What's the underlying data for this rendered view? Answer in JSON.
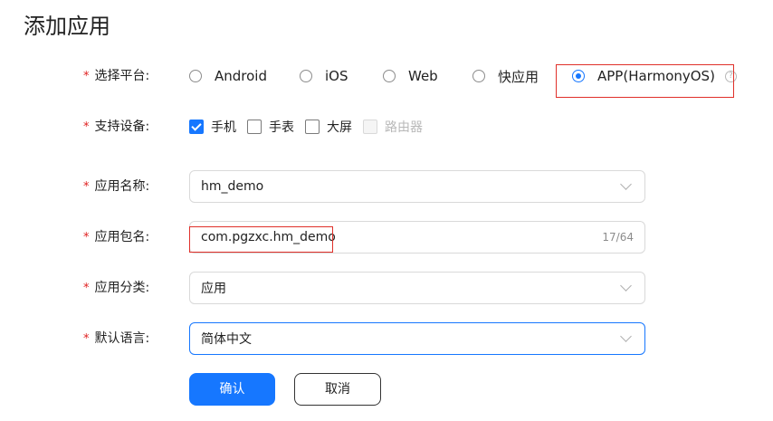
{
  "page": {
    "title": "添加应用"
  },
  "form": {
    "platform": {
      "label": "选择平台:",
      "required_mark": "*",
      "options": [
        "Android",
        "iOS",
        "Web",
        "快应用",
        "APP(HarmonyOS)"
      ],
      "selected": "APP(HarmonyOS)",
      "help_glyph": "?"
    },
    "devices": {
      "label": "支持设备:",
      "required_mark": "*",
      "options": [
        {
          "label": "手机",
          "checked": true,
          "disabled": false
        },
        {
          "label": "手表",
          "checked": false,
          "disabled": false
        },
        {
          "label": "大屏",
          "checked": false,
          "disabled": false
        },
        {
          "label": "路由器",
          "checked": false,
          "disabled": true
        }
      ]
    },
    "app_name": {
      "label": "应用名称:",
      "required_mark": "*",
      "value": "hm_demo"
    },
    "package_name": {
      "label": "应用包名:",
      "required_mark": "*",
      "value": "com.pgzxc.hm_demo",
      "counter": "17/64"
    },
    "category": {
      "label": "应用分类:",
      "required_mark": "*",
      "value": "应用"
    },
    "language": {
      "label": "默认语言:",
      "required_mark": "*",
      "value": "简体中文"
    }
  },
  "actions": {
    "confirm_label": "确认",
    "cancel_label": "取消"
  },
  "colors": {
    "accent": "#1677ff",
    "required": "#e02020",
    "highlight": "#e0302a"
  }
}
